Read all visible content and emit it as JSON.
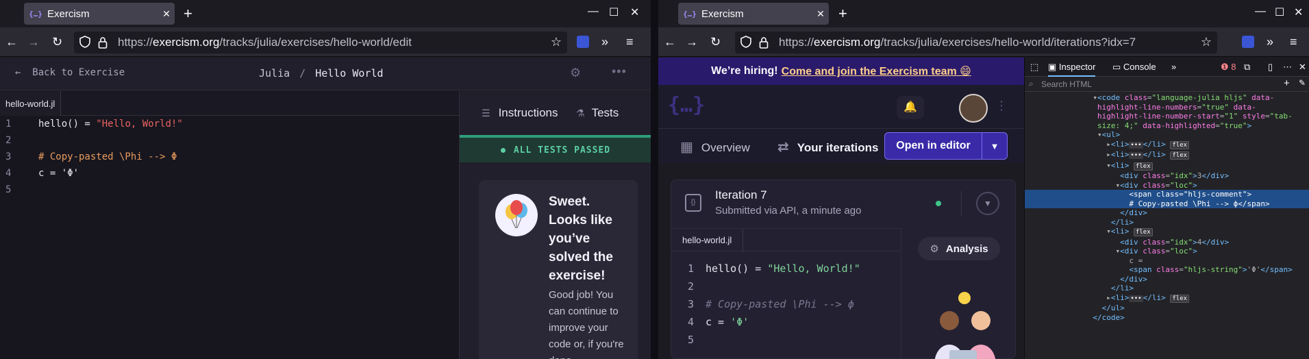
{
  "left": {
    "tab_title": "Exercism",
    "url": {
      "host": "exercism.org",
      "scheme": "https://",
      "path": "/tracks/julia/exercises/hello-world/edit"
    },
    "editor": {
      "back_label": "Back to Exercise",
      "breadcrumb_track": "Julia",
      "breadcrumb_sep": "/",
      "breadcrumb_exercise": "Hello World",
      "file_tab": "hello-world.jl",
      "lines": [
        {
          "n": "1",
          "parts": [
            [
              "def",
              "hello() = "
            ],
            [
              "str",
              "\"Hello, World!\""
            ]
          ]
        },
        {
          "n": "2",
          "parts": []
        },
        {
          "n": "3",
          "parts": [
            [
              "com",
              "# Copy-pasted \\Phi --> Φ"
            ]
          ]
        },
        {
          "n": "4",
          "parts": [
            [
              "def",
              "c = 'Φ'"
            ]
          ]
        },
        {
          "n": "5",
          "parts": []
        }
      ]
    },
    "panel": {
      "tab_instructions": "Instructions",
      "tab_tests": "Tests",
      "passed": "ALL TESTS PASSED",
      "sweet_title": "Sweet. Looks like you’ve solved the exercise!",
      "sweet_body": "Good job! You can continue to improve your code or, if you're done,"
    }
  },
  "right": {
    "tab_title": "Exercism",
    "url": {
      "host": "exercism.org",
      "scheme": "https://",
      "path": "/tracks/julia/exercises/hello-world/iterations?idx=7"
    },
    "banner_text": "We’re hiring!",
    "banner_link": "Come and join the Exercism team 😄",
    "nav_overview": "Overview",
    "nav_iterations": "Your iterations",
    "open_editor": "Open in editor",
    "iteration_title": "Iteration 7",
    "iteration_sub": "Submitted via API, a minute ago",
    "file_tab": "hello-world.jl",
    "analysis": "Analysis",
    "lines": [
      {
        "n": "1",
        "parts": [
          [
            "df",
            "hello() = "
          ],
          [
            "g",
            "\"Hello, World!\""
          ]
        ]
      },
      {
        "n": "2",
        "parts": []
      },
      {
        "n": "3",
        "parts": [
          [
            "cm",
            "# Copy-pasted \\Phi --> ϕ"
          ]
        ]
      },
      {
        "n": "4",
        "parts": [
          [
            "df",
            "c = "
          ],
          [
            "g",
            "'Φ'"
          ]
        ]
      },
      {
        "n": "5",
        "parts": []
      }
    ],
    "devtools": {
      "inspector": "Inspector",
      "console": "Console",
      "errors": "8",
      "search_placeholder": "Search HTML"
    }
  },
  "colors": {
    "accent": "#604fcd",
    "hiring_bg": "#2a1a6b",
    "passed": "#5ccfa4",
    "highlight": "#204e8a"
  }
}
